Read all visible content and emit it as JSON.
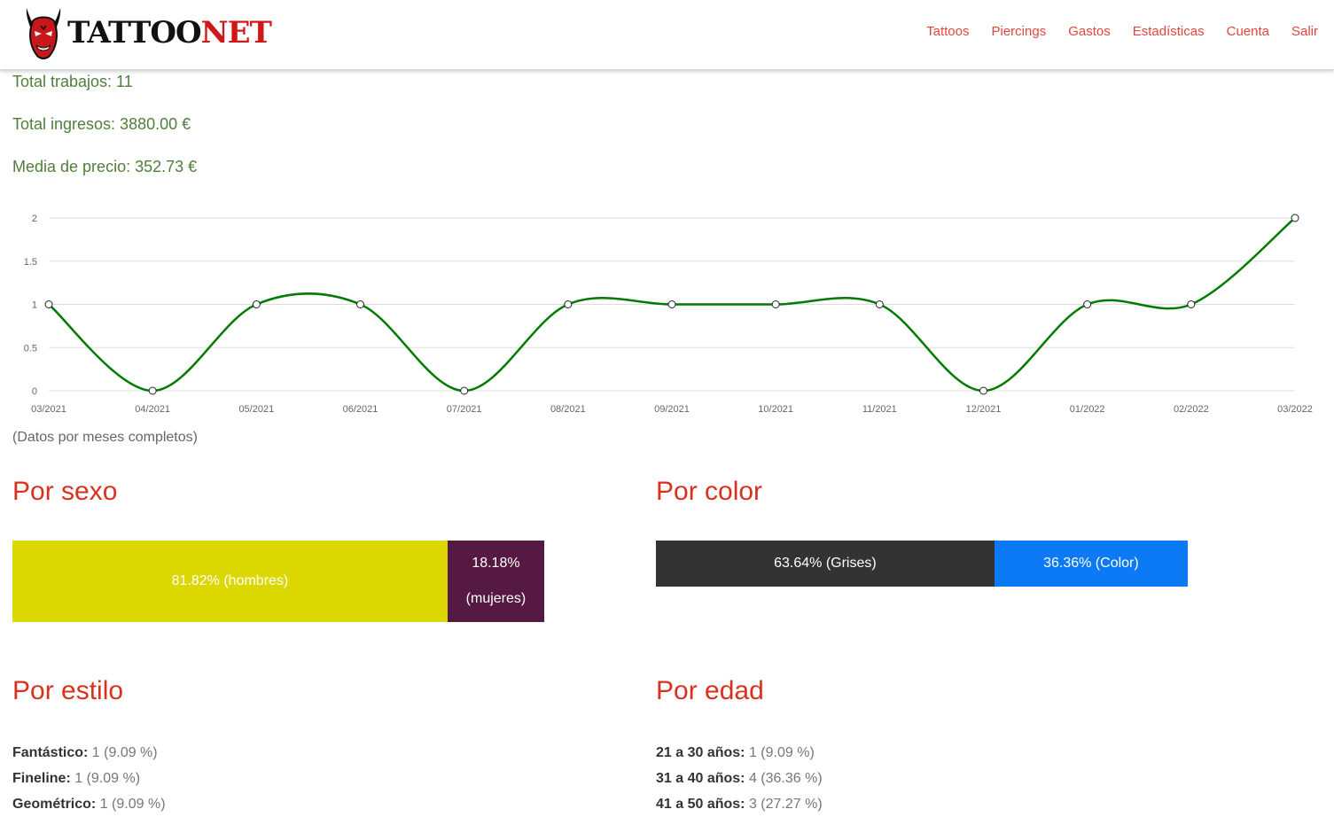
{
  "brand": {
    "part1": "TATTOO",
    "part2": "NET",
    "logo_icon": "red-demon-mask"
  },
  "nav": [
    "Tattoos",
    "Piercings",
    "Gastos",
    "Estadísticas",
    "Cuenta",
    "Salir"
  ],
  "summary": {
    "total_trabajos": "Total trabajos: 11",
    "total_ingresos": "Total ingresos: 3880.00 €",
    "media_precio": "Media de precio: 352.73 €"
  },
  "chart_data": {
    "type": "line",
    "categories": [
      "03/2021",
      "04/2021",
      "05/2021",
      "06/2021",
      "07/2021",
      "08/2021",
      "09/2021",
      "10/2021",
      "11/2021",
      "12/2021",
      "01/2022",
      "02/2022",
      "03/2022"
    ],
    "values": [
      1,
      0,
      1,
      1,
      0,
      1,
      1,
      1,
      1,
      0,
      1,
      1,
      2
    ],
    "ylim": [
      0,
      2
    ],
    "yticks": [
      "0",
      "0.5",
      "1",
      "1.5",
      "2"
    ],
    "grid": true,
    "line_color": "#007a00"
  },
  "note": "(Datos por meses completos)",
  "por_sexo": {
    "title": "Por sexo",
    "segments": [
      {
        "label": "81.82% (hombres)",
        "value": 81.82,
        "color": "#dcd700"
      },
      {
        "label": "18.18% (mujeres)",
        "value": 18.18,
        "color": "#551944"
      }
    ]
  },
  "por_color": {
    "title": "Por color",
    "segments": [
      {
        "label": "63.64% (Grises)",
        "value": 63.64,
        "color": "#333333"
      },
      {
        "label": "36.36% (Color)",
        "value": 36.36,
        "color": "#0d7af5"
      }
    ]
  },
  "por_estilo": {
    "title": "Por estilo",
    "items": [
      {
        "name": "Fantástico:",
        "value": "1 (9.09 %)"
      },
      {
        "name": "Fineline:",
        "value": "1 (9.09 %)"
      },
      {
        "name": "Geométrico:",
        "value": "1 (9.09 %)"
      }
    ]
  },
  "por_edad": {
    "title": "Por edad",
    "items": [
      {
        "name": "21 a 30 años:",
        "value": "1 (9.09 %)"
      },
      {
        "name": "31 a 40 años:",
        "value": "4 (36.36 %)"
      },
      {
        "name": "41 a 50 años:",
        "value": "3 (27.27 %)"
      }
    ]
  }
}
